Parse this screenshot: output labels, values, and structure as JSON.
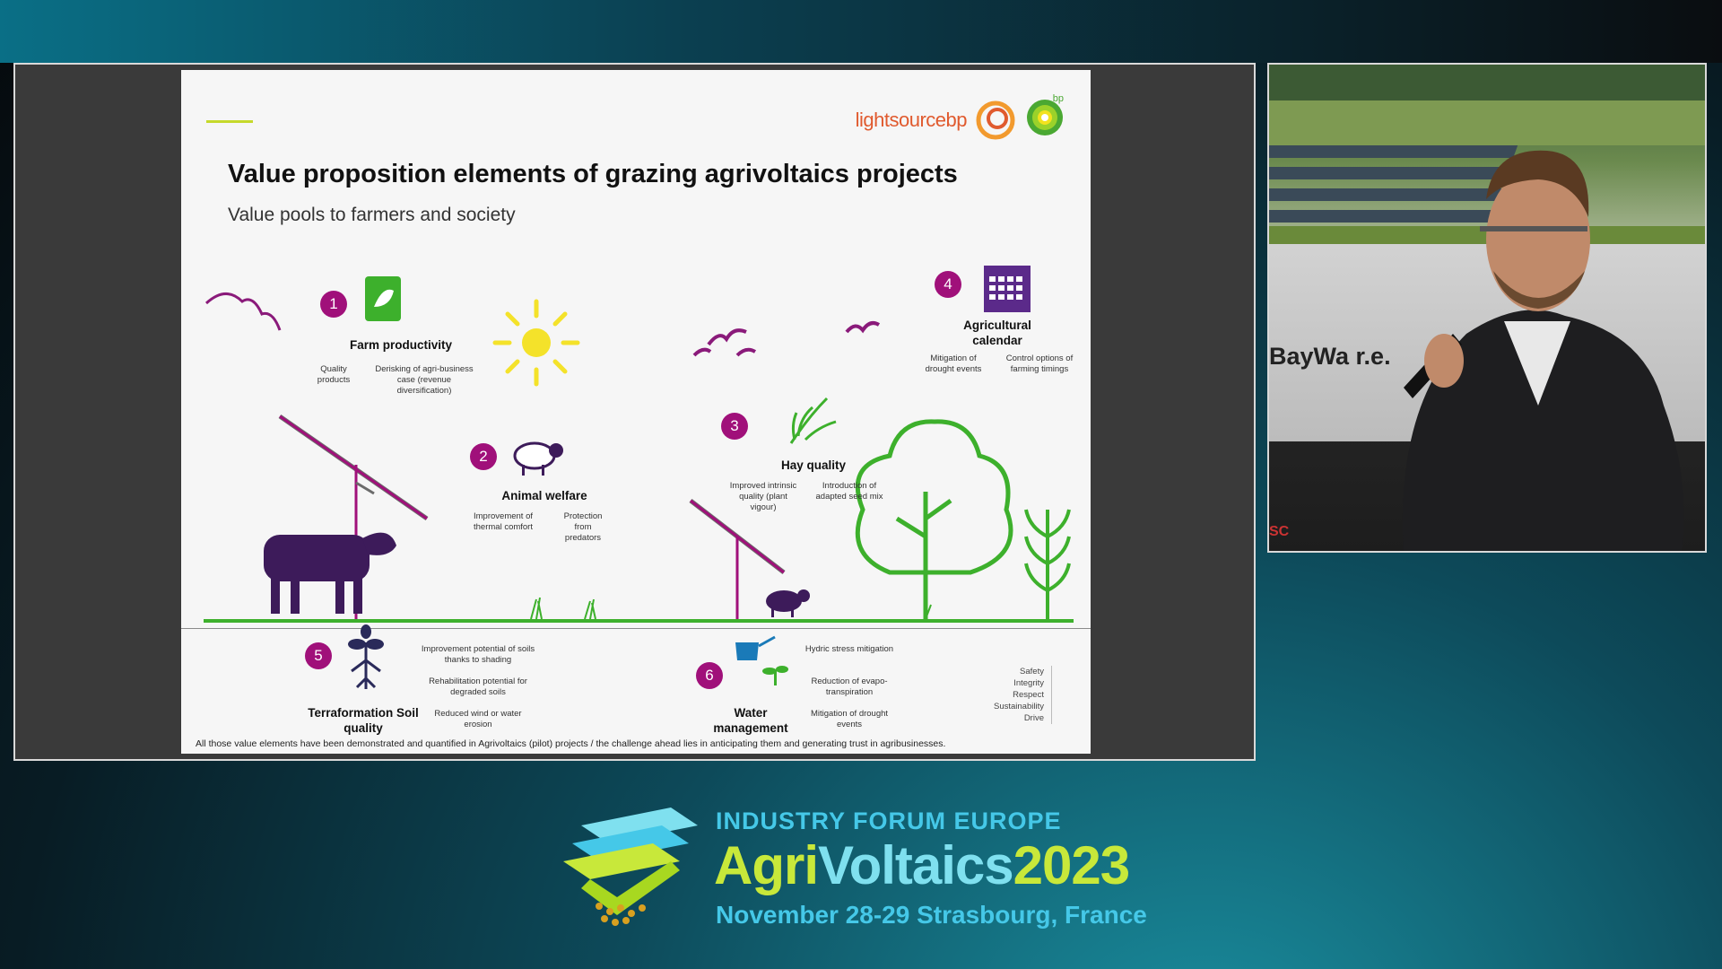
{
  "slide": {
    "logo_text": "lightsource",
    "logo_bp": "bp",
    "logo_bp_small": "bp",
    "title": "Value proposition elements of grazing agrivoltaics projects",
    "subtitle": "Value pools to farmers and society",
    "elements": [
      {
        "num": "1",
        "label": "Farm productivity",
        "notes": [
          "Quality products",
          "Derisking of agri-business case (revenue diversification)"
        ]
      },
      {
        "num": "2",
        "label": "Animal welfare",
        "notes": [
          "Improvement of thermal comfort",
          "Protection from predators"
        ]
      },
      {
        "num": "3",
        "label": "Hay quality",
        "notes": [
          "Improved intrinsic quality (plant vigour)",
          "Introduction of adapted seed mix"
        ]
      },
      {
        "num": "4",
        "label": "Agricultural calendar",
        "notes": [
          "Mitigation of drought events",
          "Control options of farming timings"
        ]
      },
      {
        "num": "5",
        "label": "Terraformation Soil quality",
        "notes": [
          "Improvement potential of soils thanks to shading",
          "Rehabilitation potential for degraded soils",
          "Reduced wind or water erosion"
        ]
      },
      {
        "num": "6",
        "label": "Water management",
        "notes": [
          "Hydric stress mitigation",
          "Reduction of evapo-transpiration",
          "Mitigation of drought events"
        ]
      }
    ],
    "values": [
      "Safety",
      "Integrity",
      "Respect",
      "Sustainability",
      "Drive"
    ],
    "footnote": "All those value elements have been demonstrated and quantified in Agrivoltaics (pilot) projects / the challenge ahead lies in anticipating them and generating trust in agribusinesses."
  },
  "video": {
    "banner_text": "BayWa r.e.",
    "corner_text": "SC"
  },
  "event": {
    "line1": "INDUSTRY FORUM EUROPE",
    "name_part1": "Agri",
    "name_part2": "Voltaics",
    "name_part3": "2023",
    "line3": "November 28-29 Strasbourg, France"
  },
  "colors": {
    "accent_magenta": "#a0107a",
    "grass_green": "#3db02c",
    "sun_yellow": "#f4e22a",
    "animal_purple": "#3d1b5a",
    "event_cyan": "#45c8e8",
    "event_lime": "#c8e83a"
  }
}
